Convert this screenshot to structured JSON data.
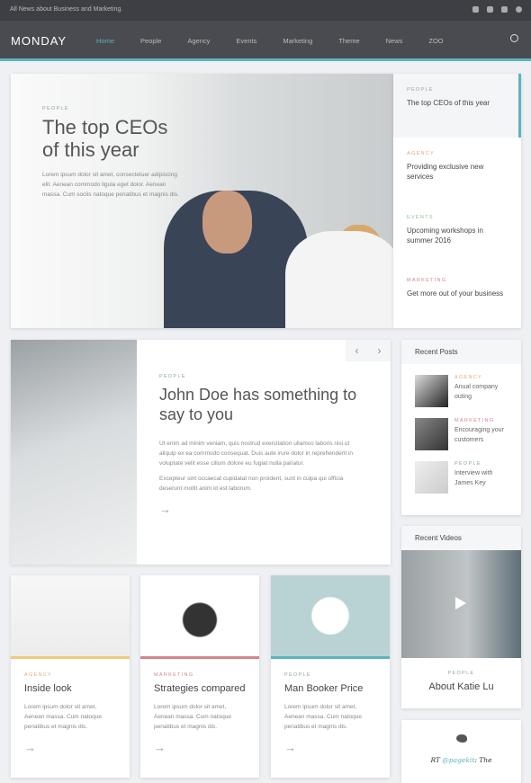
{
  "topbar": {
    "tagline": "All News about Business and Marketing.",
    "social": [
      "twitter-icon",
      "instagram-icon",
      "youtube-icon",
      "dribbble-icon"
    ]
  },
  "nav": {
    "logo": "MONDAY",
    "items": [
      "Home",
      "People",
      "Agency",
      "Events",
      "Marketing",
      "Theme",
      "News",
      "ZOO"
    ],
    "active": "Home"
  },
  "hero": {
    "category": "PEOPLE",
    "title": "The top CEOs of this year",
    "body": "Lorem ipsum dolor sit amet, consectetuer adipiscing elit. Aenean commodo ligula eget dolor. Aenean massa. Cum sociis natoque penatibus et magnis dis."
  },
  "slider_list": [
    {
      "category": "PEOPLE",
      "title": "The top CEOs of this year"
    },
    {
      "category": "AGENCY",
      "title": "Providing exclusive new services"
    },
    {
      "category": "EVENTS",
      "title": "Upcoming workshops in summer 2016"
    },
    {
      "category": "MARKETING",
      "title": "Get more out of your business"
    }
  ],
  "featured": {
    "category": "PEOPLE",
    "title": "John Doe has something to say to you",
    "p1": "Ut enim ad minim veniam, quis nostrud exercitation ullamco laboris nisi ut aliquip ex ea commodo consequat. Duis aute irure dolor in reprehenderit in voluptate velit esse cillum dolore eu fugiat nulla pariatur.",
    "p2": "Excepteur sint occaecat cupidatat non proident, sunt in culpa qui officia deserunt mollit anim id est laborum.",
    "prev": "‹",
    "next": "›",
    "more": "→"
  },
  "cards": [
    {
      "category": "AGENCY",
      "title": "Inside look",
      "body": "Lorem ipsum dolor sit amet, Aenean massa. Cum natoque penatibus et magnis dis.",
      "more": "→",
      "color": "#f0c97a"
    },
    {
      "category": "MARKETING",
      "title": "Strategies compared",
      "body": "Lorem ipsum dolor sit amet, Aenean massa. Cum natoque penatibus et magnis dis.",
      "more": "→",
      "color": "#d7848c"
    },
    {
      "category": "PEOPLE",
      "title": "Man Booker Price",
      "body": "Lorem ipsum dolor sit amet, Aenean massa. Cum natoque penatibus et magnis dis.",
      "more": "→",
      "color": "#5bb4bd"
    }
  ],
  "recent_posts": {
    "title": "Recent Posts",
    "items": [
      {
        "category": "AGENCY",
        "title": "Anual company outing"
      },
      {
        "category": "MARKETING",
        "title": "Encouraging your customers"
      },
      {
        "category": "PEOPLE",
        "title": "Interview with James Key"
      }
    ]
  },
  "recent_videos": {
    "title": "Recent Videos",
    "category": "PEOPLE",
    "title_item": "About Katie Lu"
  },
  "twitter": {
    "prefix": "RT ",
    "handle": "@pagekit",
    "rest": ": The"
  }
}
